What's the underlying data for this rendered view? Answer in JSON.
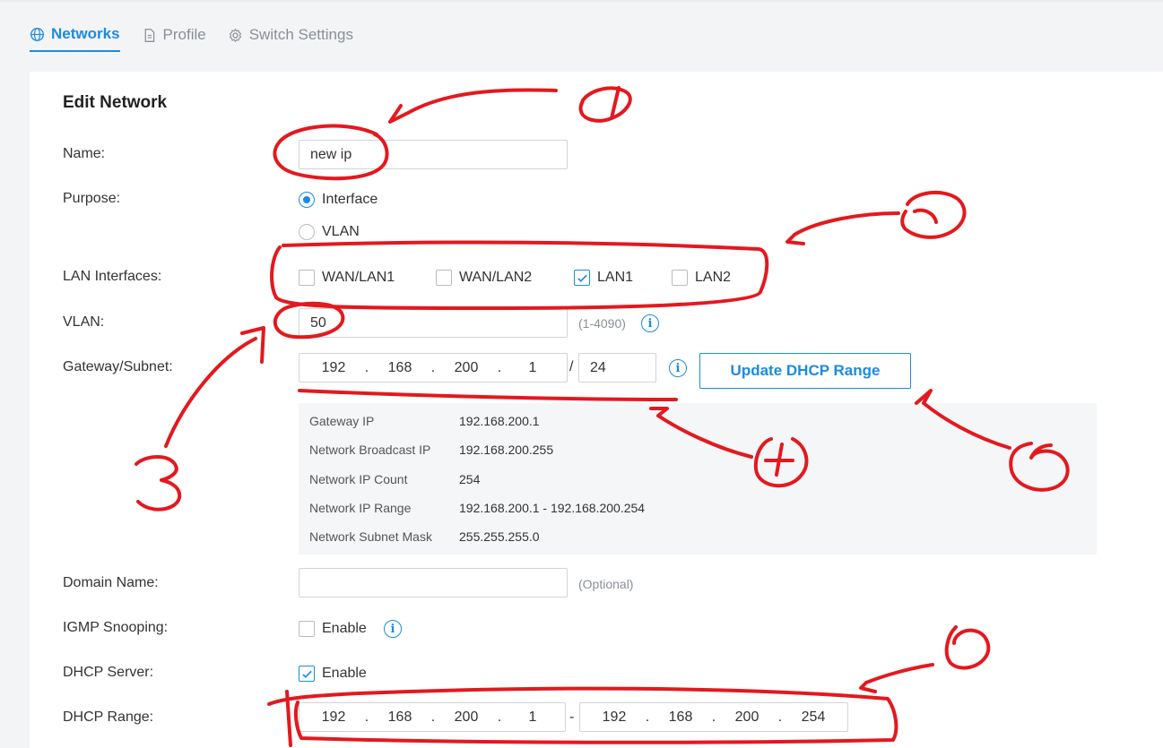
{
  "tabs": [
    {
      "label": "Networks",
      "icon": "globe-icon",
      "active": true
    },
    {
      "label": "Profile",
      "icon": "document-icon",
      "active": false
    },
    {
      "label": "Switch Settings",
      "icon": "gear-icon",
      "active": false
    }
  ],
  "form": {
    "title": "Edit Network",
    "name_label": "Name:",
    "name_value": "new ip",
    "purpose_label": "Purpose:",
    "purpose_options": [
      "Interface",
      "VLAN"
    ],
    "purpose_selected": "Interface",
    "lan_label": "LAN Interfaces:",
    "lan_options": [
      {
        "label": "WAN/LAN1",
        "checked": false
      },
      {
        "label": "WAN/LAN2",
        "checked": false
      },
      {
        "label": "LAN1",
        "checked": true
      },
      {
        "label": "LAN2",
        "checked": false
      }
    ],
    "vlan_label": "VLAN:",
    "vlan_value": "50",
    "vlan_hint": "(1-4090)",
    "gateway_label": "Gateway/Subnet:",
    "gateway_octets": [
      "192",
      "168",
      "200",
      "1"
    ],
    "subnet_sep": "/",
    "subnet_value": "24",
    "update_button": "Update DHCP Range",
    "network_info": [
      {
        "key": "Gateway IP",
        "value": "192.168.200.1"
      },
      {
        "key": "Network Broadcast IP",
        "value": "192.168.200.255"
      },
      {
        "key": "Network IP Count",
        "value": "254"
      },
      {
        "key": "Network IP Range",
        "value": "192.168.200.1 - 192.168.200.254"
      },
      {
        "key": "Network Subnet Mask",
        "value": "255.255.255.0"
      }
    ],
    "domain_label": "Domain Name:",
    "domain_value": "",
    "domain_hint": "(Optional)",
    "igmp_label": "IGMP Snooping:",
    "igmp_option": "Enable",
    "igmp_checked": false,
    "dhcp_label": "DHCP Server:",
    "dhcp_option": "Enable",
    "dhcp_checked": true,
    "dhcp_range_label": "DHCP Range:",
    "dhcp_range_sep": "-",
    "dhcp_start_octets": [
      "192",
      "168",
      "200",
      "1"
    ],
    "dhcp_end_octets": [
      "192",
      "168",
      "200",
      "254"
    ]
  },
  "annotation_color": "#e3191e",
  "accent_color": "#1a8ce0"
}
